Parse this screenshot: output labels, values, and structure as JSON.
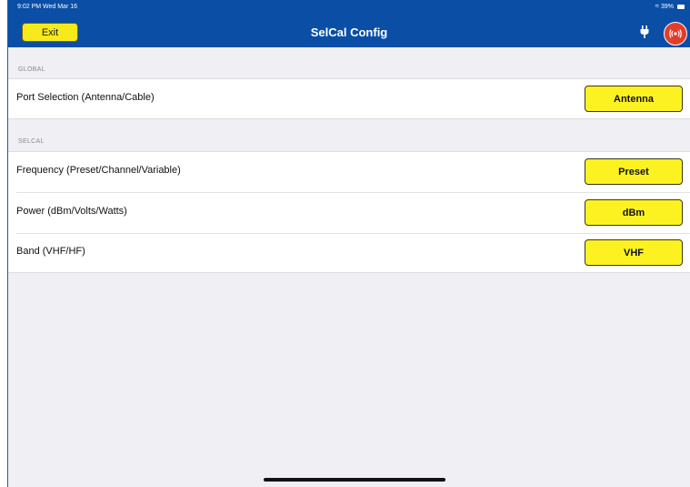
{
  "status_bar": {
    "time": "9:02 PM  Wed Mar 16",
    "battery": "39%"
  },
  "navbar": {
    "exit_label": "Exit",
    "title": "SelCal Config",
    "icons": [
      "plug-icon",
      "radio-transmit-icon"
    ],
    "color": "#0a4ea6"
  },
  "sections": {
    "global": {
      "header": "GLOBAL",
      "rows": [
        {
          "label": "Port Selection (Antenna/Cable)",
          "value": "Antenna"
        }
      ]
    },
    "selcal": {
      "header": "SELCAL",
      "rows": [
        {
          "label": "Frequency (Preset/Channel/Variable)",
          "value": "Preset"
        },
        {
          "label": "Power (dBm/Volts/Watts)",
          "value": "dBm"
        },
        {
          "label": "Band (VHF/HF)",
          "value": "VHF"
        }
      ]
    }
  },
  "colors": {
    "button_yellow": "#fdf221",
    "background": "#efeff4",
    "transmit_red": "#e43c2b"
  }
}
